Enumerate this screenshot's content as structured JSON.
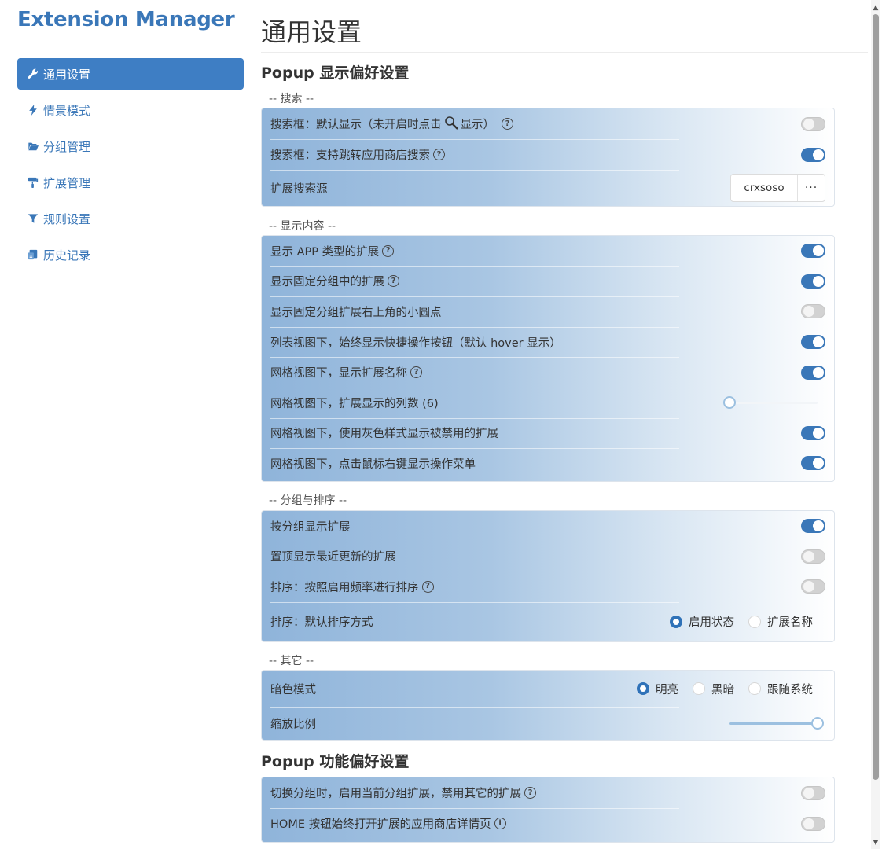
{
  "app": {
    "title": "Extension Manager"
  },
  "nav": [
    {
      "label": "通用设置",
      "icon": "wrench-icon",
      "active": true
    },
    {
      "label": "情景模式",
      "icon": "bolt-icon",
      "active": false
    },
    {
      "label": "分组管理",
      "icon": "folder-open-icon",
      "active": false
    },
    {
      "label": "扩展管理",
      "icon": "paint-roller-icon",
      "active": false
    },
    {
      "label": "规则设置",
      "icon": "funnel-icon",
      "active": false
    },
    {
      "label": "历史记录",
      "icon": "history-icon",
      "active": false
    }
  ],
  "page": {
    "title": "通用设置"
  },
  "popup_display": {
    "heading": "Popup 显示偏好设置",
    "search": {
      "label": "--  搜索  --",
      "row1_prefix": "搜索框：默认显示（未开启时点击",
      "row1_suffix": "显示）",
      "row1_on": false,
      "row2": "搜索框：支持跳转应用商店搜索",
      "row2_on": true,
      "row3": "扩展搜索源",
      "row3_value": "crxsoso",
      "row3_more": "···"
    },
    "content": {
      "label": "--  显示内容  --",
      "rows": [
        {
          "text": "显示 APP 类型的扩展",
          "help": true,
          "on": true
        },
        {
          "text": "显示固定分组中的扩展",
          "help": true,
          "on": true
        },
        {
          "text": "显示固定分组扩展右上角的小圆点",
          "help": false,
          "on": false
        },
        {
          "text": "列表视图下，始终显示快捷操作按钮（默认 hover 显示）",
          "help": false,
          "on": true
        },
        {
          "text": "网格视图下，显示扩展名称",
          "help": true,
          "on": true
        }
      ],
      "columns_row": "网格视图下，扩展显示的列数 (6)",
      "columns_level": 0,
      "rows2": [
        {
          "text": "网格视图下，使用灰色样式显示被禁用的扩展",
          "on": true
        },
        {
          "text": "网格视图下，点击鼠标右键显示操作菜单",
          "on": true
        }
      ]
    },
    "group_sort": {
      "label": "--  分组与排序  --",
      "rows": [
        {
          "text": "按分组显示扩展",
          "help": false,
          "on": true
        },
        {
          "text": "置顶显示最近更新的扩展",
          "help": false,
          "on": false
        },
        {
          "text": "排序：按照启用频率进行排序",
          "help": true,
          "on": false
        }
      ],
      "sort_row": "排序：默认排序方式",
      "sort_options": [
        "启用状态",
        "扩展名称"
      ],
      "sort_selected": 0
    },
    "other": {
      "label": "--  其它  --",
      "dark_row": "暗色模式",
      "dark_options": [
        "明亮",
        "黑暗",
        "跟随系统"
      ],
      "dark_selected": 0,
      "zoom_row": "缩放比例",
      "zoom_level": 1
    }
  },
  "popup_function": {
    "heading": "Popup 功能偏好设置",
    "rows": [
      {
        "text": "切换分组时，启用当前分组扩展，禁用其它的扩展",
        "icon": "help-icon",
        "glyph": "?",
        "on": false
      },
      {
        "text": "HOME 按钮始终打开扩展的应用商店详情页",
        "icon": "info-icon",
        "glyph": "i",
        "on": false
      }
    ]
  },
  "glyphs": {
    "help": "?",
    "info": "i",
    "up": "▲",
    "down": "▼"
  },
  "colors": {
    "accent": "#3a77b8",
    "nav_active": "#3e7ec4",
    "toggle_on": "#3a77b8",
    "toggle_off": "#d2d2d2"
  }
}
